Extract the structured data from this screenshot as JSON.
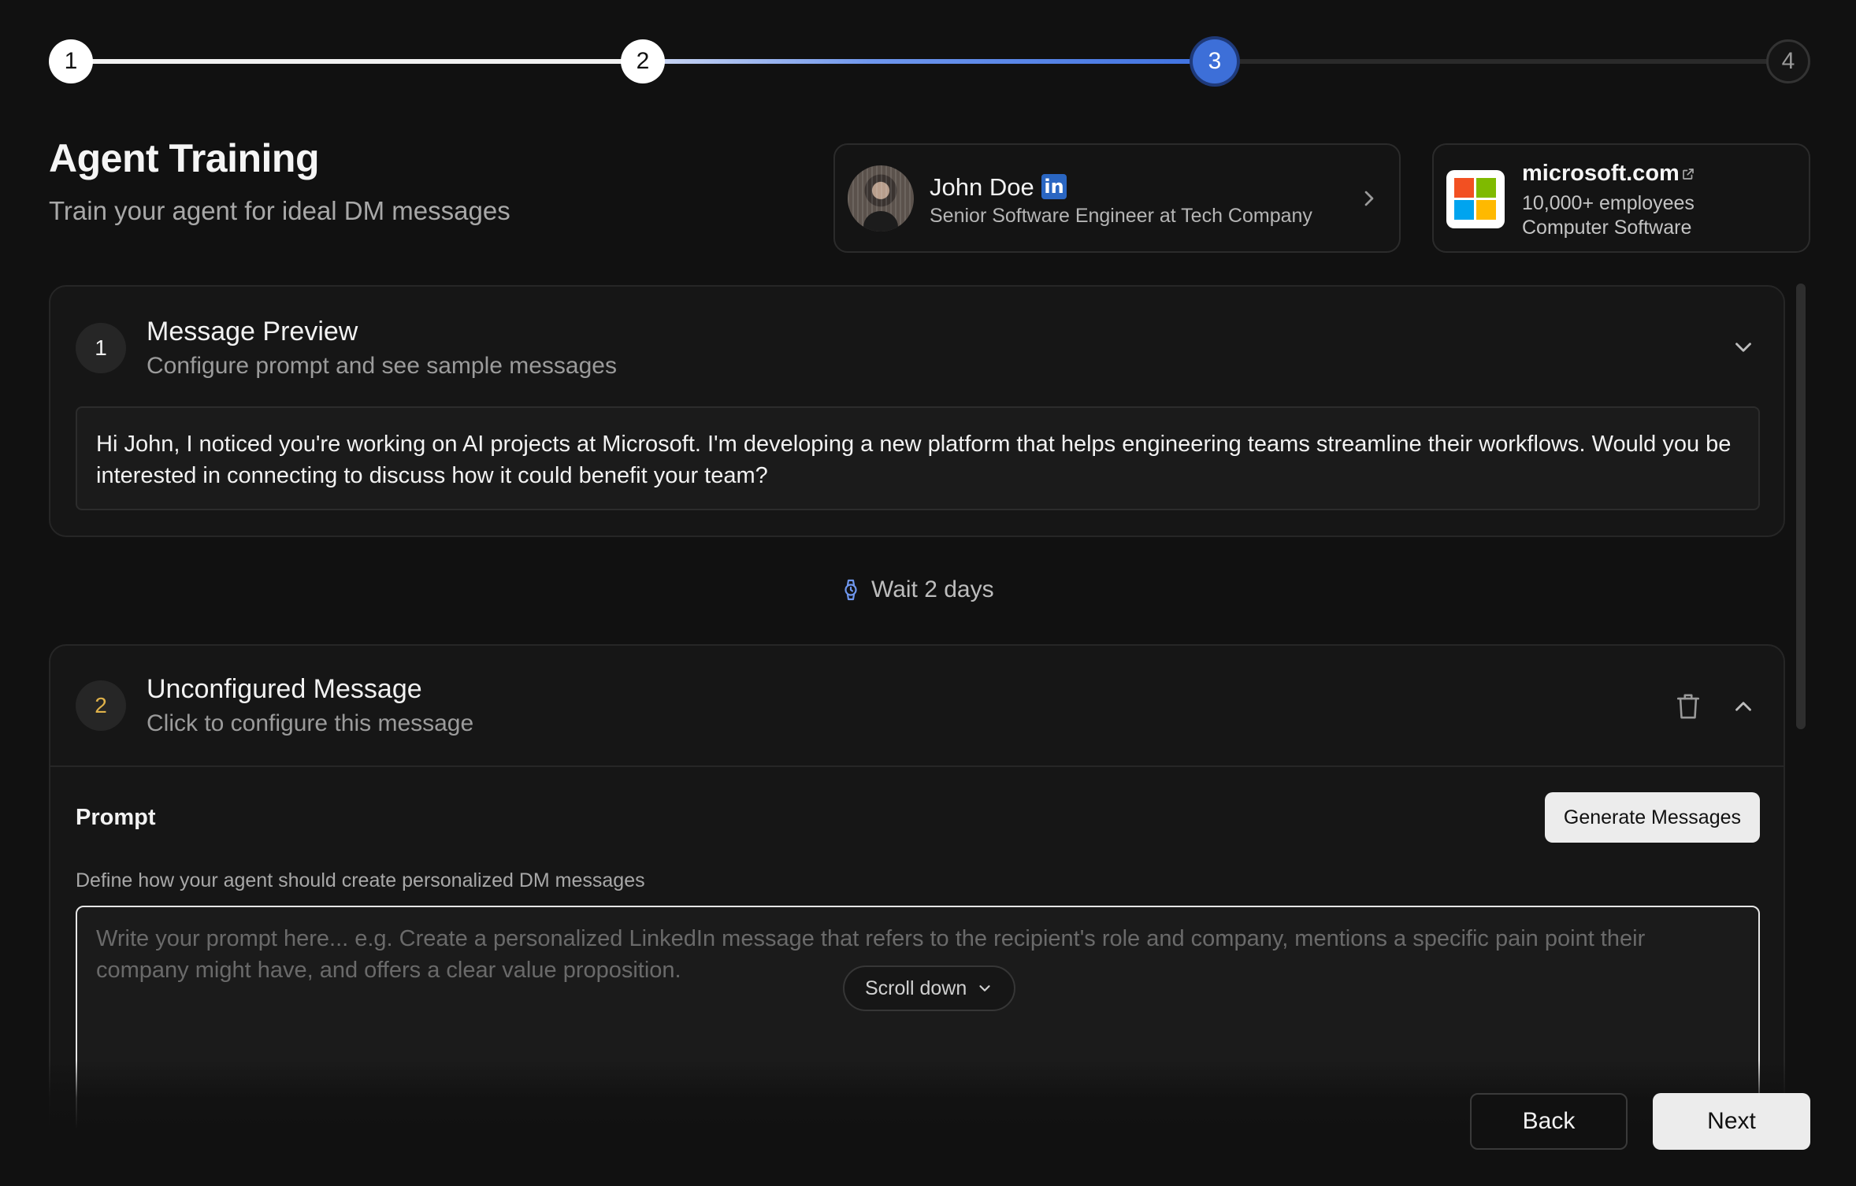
{
  "stepper": {
    "steps": [
      {
        "label": "1",
        "state": "done"
      },
      {
        "label": "2",
        "state": "done"
      },
      {
        "label": "3",
        "state": "active"
      },
      {
        "label": "4",
        "state": "todo"
      }
    ]
  },
  "header": {
    "title": "Agent Training",
    "subtitle": "Train your agent for ideal DM messages"
  },
  "profile": {
    "name": "John Doe",
    "linkedin_icon": "linkedin-icon",
    "linkedin_glyph": "in",
    "role": "Senior Software Engineer at Tech Company"
  },
  "company": {
    "domain": "microsoft.com",
    "size": "10,000+ employees",
    "industry": "Computer Software",
    "logo_colors": [
      "#f25022",
      "#7fba00",
      "#00a4ef",
      "#ffb900"
    ]
  },
  "messages": [
    {
      "number": "1",
      "title": "Message Preview",
      "subtitle": "Configure prompt and see sample messages",
      "preview": "Hi John, I noticed you're working on AI projects at Microsoft. I'm developing a new platform that helps engineering teams streamline their workflows. Would you be interested in connecting to discuss how it could benefit your team?"
    },
    {
      "number": "2",
      "title": "Unconfigured Message",
      "subtitle": "Click to configure this message",
      "prompt_label": "Prompt",
      "generate_label": "Generate Messages",
      "prompt_help": "Define how your agent should create personalized DM messages",
      "prompt_placeholder": "Write your prompt here... e.g. Create a personalized LinkedIn message that refers to the recipient's role and company, mentions a specific pain point their company might have, and offers a clear value proposition."
    }
  ],
  "wait": {
    "label": "Wait 2 days"
  },
  "scroll_hint": {
    "label": "Scroll down"
  },
  "footer": {
    "back_label": "Back",
    "next_label": "Next"
  },
  "colors": {
    "accent": "#3d6fd8",
    "badge_number_2": "#e0b24a",
    "background": "#111111"
  }
}
